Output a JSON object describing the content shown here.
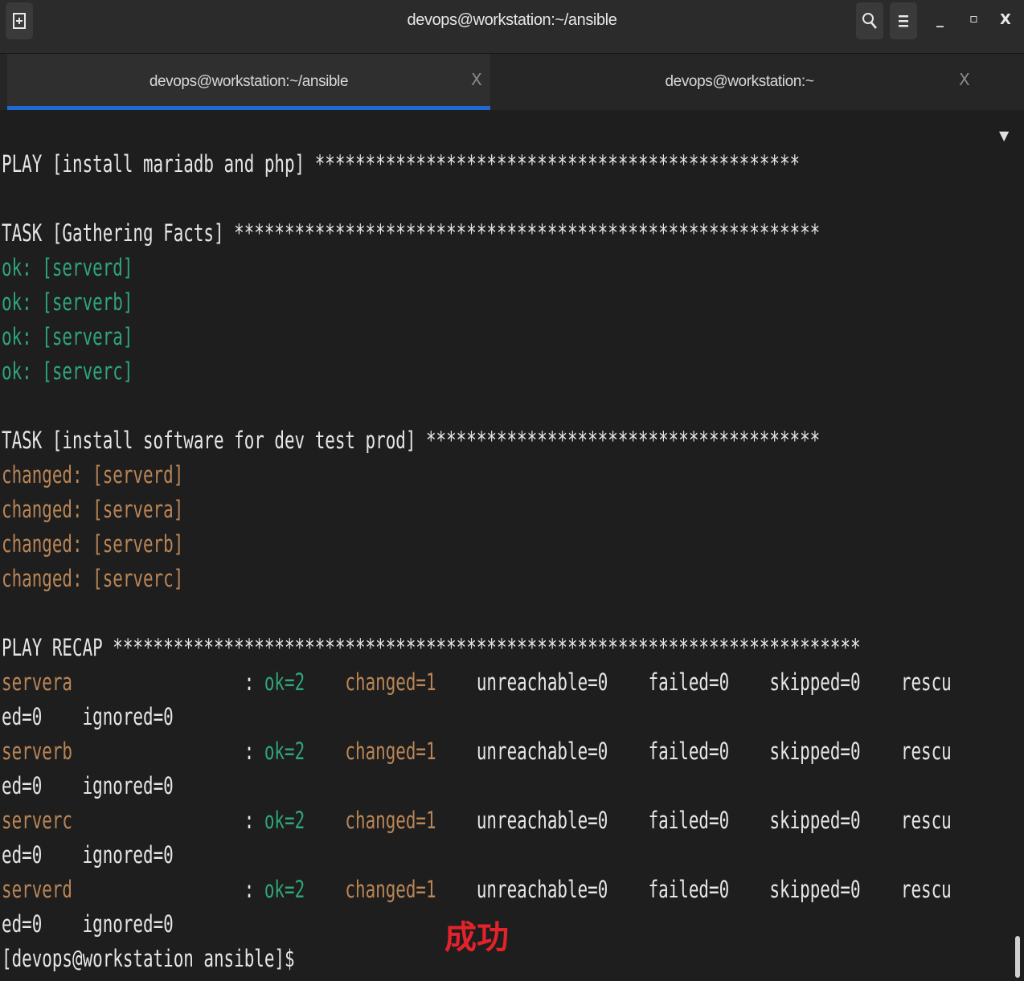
{
  "window": {
    "title": "devops@workstation:~/ansible",
    "new_tab_icon": "new-tab-icon",
    "search_icon": "search-icon",
    "menu_icon": "hamburger-menu-icon",
    "minimize_glyph": "_",
    "maximize_glyph": "▫",
    "close_glyph": "X"
  },
  "tabs": [
    {
      "label": "devops@workstation:~/ansible",
      "close": "X",
      "active": true
    },
    {
      "label": "devops@workstation:~",
      "close": "X",
      "active": false
    }
  ],
  "tabs_menu_glyph": "▼",
  "colors": {
    "ok": "#2fa579",
    "changed": "#b98556",
    "text": "#e6e6e6",
    "accent": "#1f6ad1",
    "annotation": "#e3232b"
  },
  "terminal": {
    "play_header": "PLAY [install mariadb and php] ************************************************",
    "task1_header": "TASK [Gathering Facts] **********************************************************",
    "task1_results": [
      "ok: [serverd]",
      "ok: [serverb]",
      "ok: [servera]",
      "ok: [serverc]"
    ],
    "task2_header": "TASK [install software for dev test prod] ***************************************",
    "task2_results": [
      "changed: [serverd]",
      "changed: [servera]",
      "changed: [serverb]",
      "changed: [serverc]"
    ],
    "recap_header": "PLAY RECAP **************************************************************************",
    "recap": [
      {
        "host": "servera",
        "colon": ":",
        "ok": "ok=2",
        "changed": "changed=1",
        "unreachable": "unreachable=0",
        "failed": "failed=0",
        "skipped": "skipped=0",
        "rescued_part1": "rescu",
        "rescued_part2": "ed=0",
        "ignored": "ignored=0"
      },
      {
        "host": "serverb",
        "colon": ":",
        "ok": "ok=2",
        "changed": "changed=1",
        "unreachable": "unreachable=0",
        "failed": "failed=0",
        "skipped": "skipped=0",
        "rescued_part1": "rescu",
        "rescued_part2": "ed=0",
        "ignored": "ignored=0"
      },
      {
        "host": "serverc",
        "colon": ":",
        "ok": "ok=2",
        "changed": "changed=1",
        "unreachable": "unreachable=0",
        "failed": "failed=0",
        "skipped": "skipped=0",
        "rescued_part1": "rescu",
        "rescued_part2": "ed=0",
        "ignored": "ignored=0"
      },
      {
        "host": "serverd",
        "colon": ":",
        "ok": "ok=2",
        "changed": "changed=1",
        "unreachable": "unreachable=0",
        "failed": "failed=0",
        "skipped": "skipped=0",
        "rescued_part1": "rescu",
        "rescued_part2": "ed=0",
        "ignored": "ignored=0"
      }
    ],
    "prompt": "[devops@workstation ansible]$"
  },
  "annotation": "成功"
}
